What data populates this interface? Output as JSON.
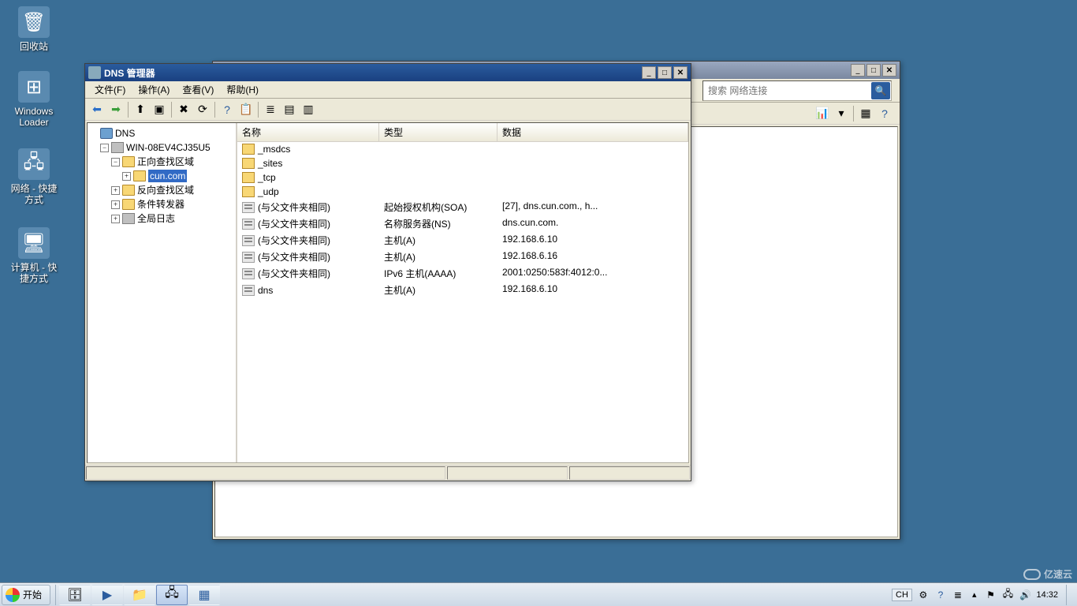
{
  "desktop": {
    "icons": [
      {
        "label": "回收站"
      },
      {
        "label": "Windows\nLoader"
      },
      {
        "label": "网络 - 快捷\n方式"
      },
      {
        "label": "计算机 - 快\n捷方式"
      }
    ]
  },
  "back_window": {
    "search_placeholder": "搜索 网络连接"
  },
  "dns_window": {
    "title": "DNS 管理器",
    "menus": [
      "文件(F)",
      "操作(A)",
      "查看(V)",
      "帮助(H)"
    ],
    "tree": {
      "root": "DNS",
      "server": "WIN-08EV4CJ35U5",
      "forward": "正向查找区域",
      "zone": "cun.com",
      "reverse": "反向查找区域",
      "cond": "条件转发器",
      "log": "全局日志"
    },
    "columns": [
      "名称",
      "类型",
      "数据"
    ],
    "records": [
      {
        "name": "_msdcs",
        "type": "",
        "data": "",
        "icon": "folder"
      },
      {
        "name": "_sites",
        "type": "",
        "data": "",
        "icon": "folder"
      },
      {
        "name": "_tcp",
        "type": "",
        "data": "",
        "icon": "folder"
      },
      {
        "name": "_udp",
        "type": "",
        "data": "",
        "icon": "folder"
      },
      {
        "name": "(与父文件夹相同)",
        "type": "起始授权机构(SOA)",
        "data": "[27], dns.cun.com., h...",
        "icon": "rec"
      },
      {
        "name": "(与父文件夹相同)",
        "type": "名称服务器(NS)",
        "data": "dns.cun.com.",
        "icon": "rec"
      },
      {
        "name": "(与父文件夹相同)",
        "type": "主机(A)",
        "data": "192.168.6.10",
        "icon": "rec"
      },
      {
        "name": "(与父文件夹相同)",
        "type": "主机(A)",
        "data": "192.168.6.16",
        "icon": "rec"
      },
      {
        "name": "(与父文件夹相同)",
        "type": "IPv6 主机(AAAA)",
        "data": "2001:0250:583f:4012:0...",
        "icon": "rec"
      },
      {
        "name": "dns",
        "type": "主机(A)",
        "data": "192.168.6.10",
        "icon": "rec"
      }
    ]
  },
  "taskbar": {
    "start": "开始",
    "ime": "CH",
    "clock": "14:32"
  },
  "watermark": "亿速云"
}
